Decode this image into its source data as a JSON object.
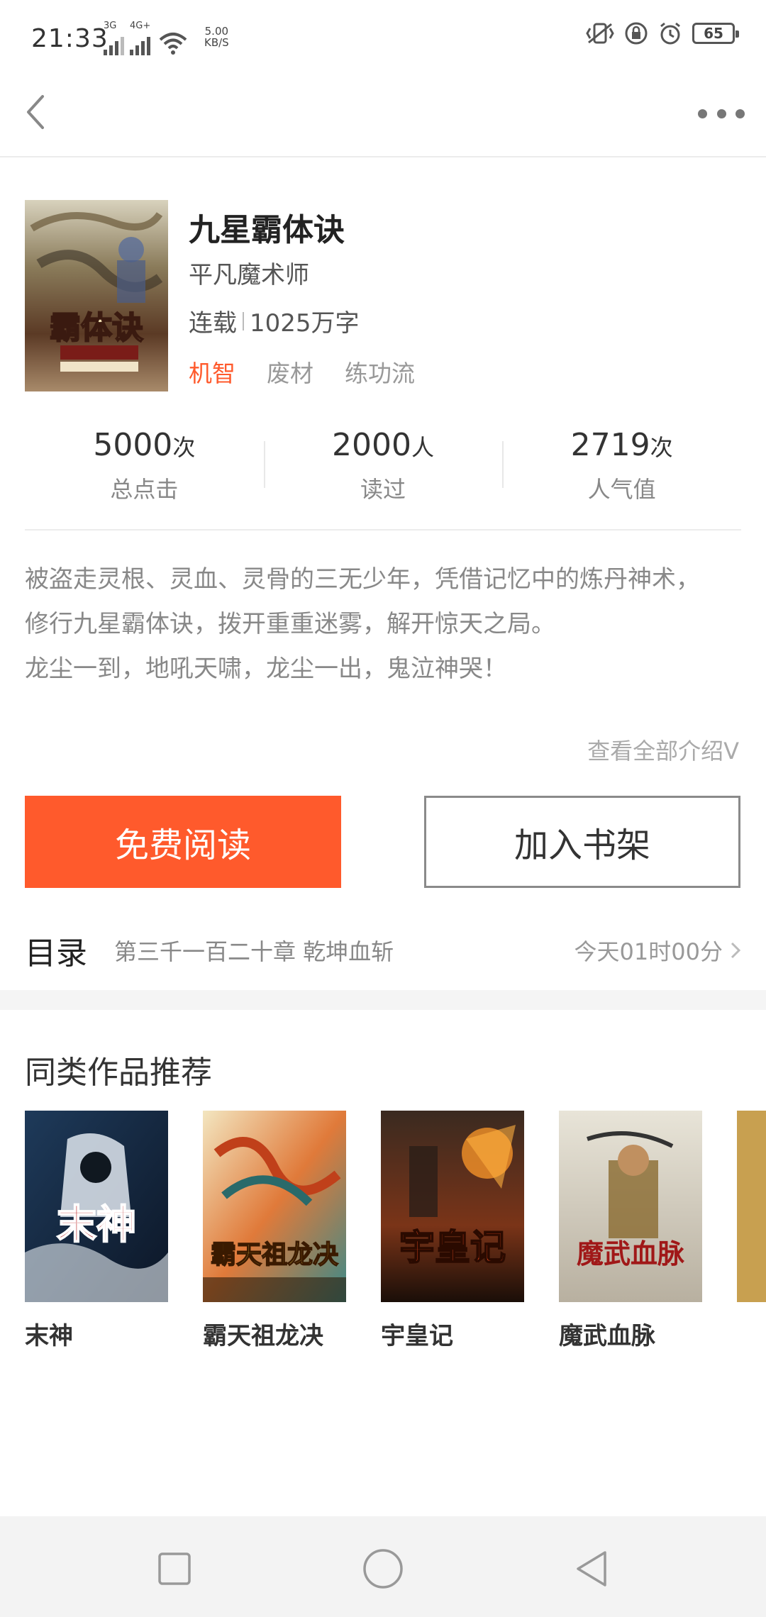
{
  "status_bar": {
    "time": "21:33",
    "net1": "3G",
    "net2": "4G+",
    "speed_value": "5.00",
    "speed_unit": "KB/S",
    "battery": "65"
  },
  "nav": {
    "back_icon": "chevron-left-icon",
    "more_icon": "more-dots-icon"
  },
  "book": {
    "title": "九星霸体诀",
    "author": "平凡魔术师",
    "status": "连载",
    "word_count": "1025万字",
    "tags": [
      "机智",
      "废材",
      "练功流"
    ],
    "cover_text": "霸体诀"
  },
  "stats": [
    {
      "value": "5000",
      "unit": "次",
      "label": "总点击"
    },
    {
      "value": "2000",
      "unit": "人",
      "label": "读过"
    },
    {
      "value": "2719",
      "unit": "次",
      "label": "人气值"
    }
  ],
  "description": {
    "lines": [
      "被盗走灵根、灵血、灵骨的三无少年，凭借记忆中的炼丹神术，",
      "修行九星霸体诀，拨开重重迷雾，解开惊天之局。",
      "龙尘一到，地吼天啸，龙尘一出，鬼泣神哭！"
    ],
    "more_label": "查看全部介绍V"
  },
  "actions": {
    "read_label": "免费阅读",
    "shelf_label": "加入书架"
  },
  "catalog": {
    "title": "目录",
    "latest_chapter": "第三千一百二十章 乾坤血斩",
    "update_time": "今天01时00分"
  },
  "recommend": {
    "title": "同类作品推荐",
    "items": [
      {
        "name": "末神",
        "cover_text": "末神"
      },
      {
        "name": "霸天祖龙决",
        "cover_text": "霸天祖龙决"
      },
      {
        "name": "宇皇记",
        "cover_text": "宇皇记"
      },
      {
        "name": "魔武血脉",
        "cover_text": "魔武血脉"
      }
    ]
  },
  "colors": {
    "accent": "#ff5a2c",
    "divider": "#ececec"
  }
}
